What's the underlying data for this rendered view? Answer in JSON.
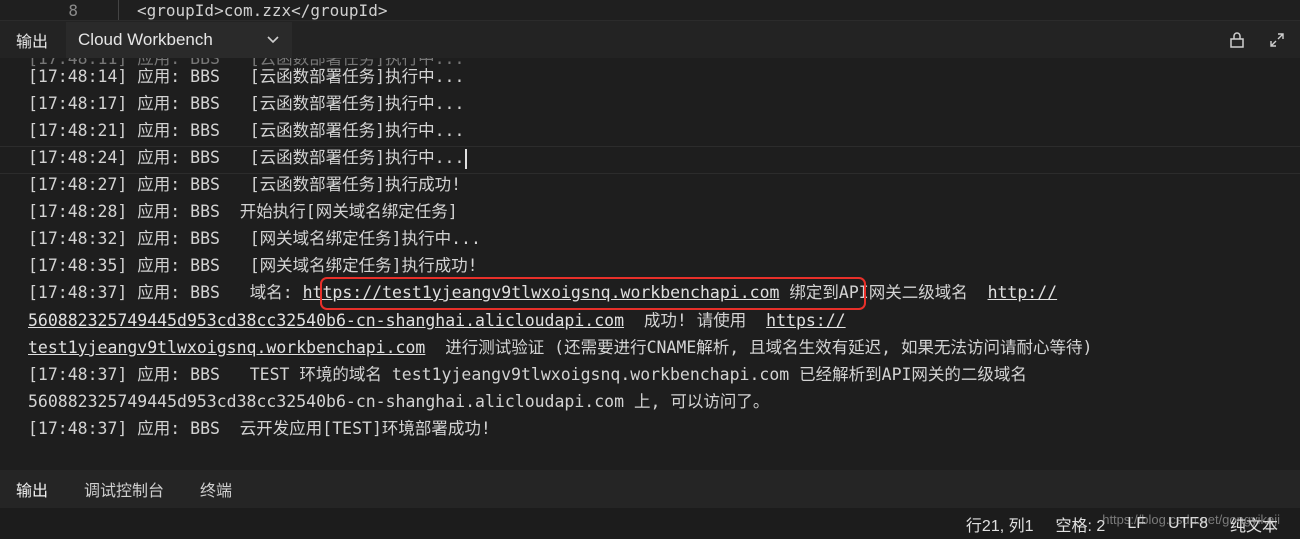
{
  "editor": {
    "line_number": "8",
    "code": "<groupId>com.zzx</groupId>"
  },
  "panel": {
    "title": "输出",
    "source": "Cloud Workbench",
    "icons": {
      "lock": "lock-icon",
      "expand": "expand-icon",
      "chevron": "chevron-down-icon"
    }
  },
  "log": {
    "lines": [
      "[17:48:14] 应用: BBS   [云函数部署任务]执行中...",
      "[17:48:17] 应用: BBS   [云函数部署任务]执行中...",
      "[17:48:21] 应用: BBS   [云函数部署任务]执行中...",
      "[17:48:24] 应用: BBS   [云函数部署任务]执行中...",
      "[17:48:27] 应用: BBS   [云函数部署任务]执行成功!",
      "[17:48:28] 应用: BBS  开始执行[网关域名绑定任务]",
      "[17:48:32] 应用: BBS   [网关域名绑定任务]执行中...",
      "[17:48:35] 应用: BBS   [网关域名绑定任务]执行成功!"
    ],
    "domain_line": {
      "prefix": "[17:48:37] 应用: BBS   域名: ",
      "url": "https://test1yjeangv9tlwxoigsnq.workbenchapi.com",
      "middle": " 绑定到API网关二级域名  ",
      "gateway_url_start": "http://",
      "gateway_url_rest": "560882325749445d953cd38cc32540b6-cn-shanghai.alicloudapi.com",
      "success": "  成功! 请使用  ",
      "use_url_start": "https://",
      "use_url_rest": "test1yjeangv9tlwxoigsnq.workbenchapi.com",
      "tail": "  进行测试验证 (还需要进行CNAME解析, 且域名生效有延迟, 如果无法访问请耐心等待)"
    },
    "test_line_1": "[17:48:37] 应用: BBS   TEST 环境的域名 test1yjeangv9tlwxoigsnq.workbenchapi.com 已经解析到API网关的二级域名",
    "test_line_2": "560882325749445d953cd38cc32540b6-cn-shanghai.alicloudapi.com 上, 可以访问了。",
    "final_line": "[17:48:37] 应用: BBS  云开发应用[TEST]环境部署成功!",
    "highlight_color": "#e8302a"
  },
  "bottom_tabs": [
    "输出",
    "调试控制台",
    "终端"
  ],
  "status": {
    "position": "行21, 列1",
    "indent": "空格: 2",
    "eol": "LF",
    "encoding": "UTF8",
    "language": "纯文本",
    "watermark": "https://blog.csdn.net/gongyikeji"
  }
}
